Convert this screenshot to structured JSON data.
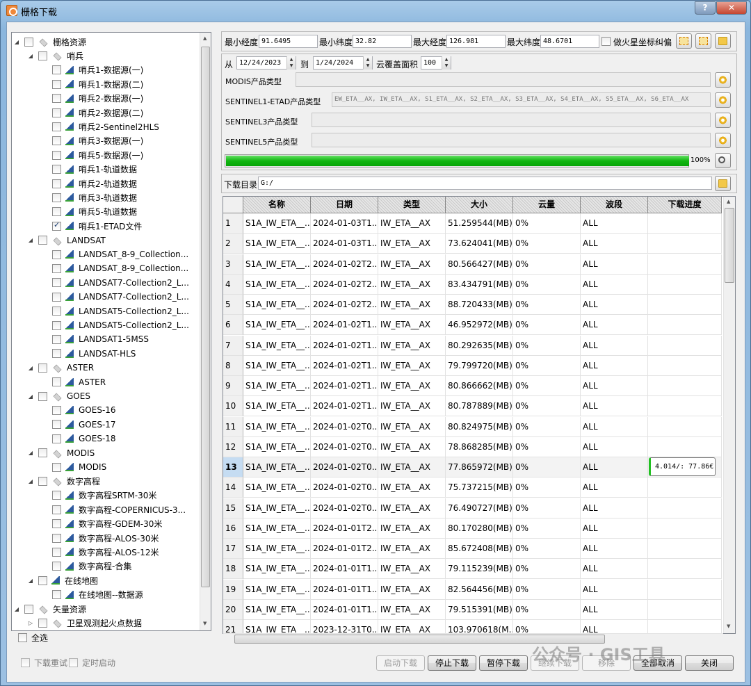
{
  "window": {
    "title": "栅格下载",
    "help_label": "?",
    "close_label": "✕"
  },
  "tree": {
    "items": [
      {
        "label": "栅格资源",
        "level": 0,
        "type": "layer",
        "expanded": true,
        "checked": false
      },
      {
        "label": "哨兵",
        "level": 1,
        "type": "layer",
        "expanded": true,
        "checked": false
      },
      {
        "label": "哨兵1-数据源(一)",
        "level": 2,
        "type": "raster",
        "checked": false
      },
      {
        "label": "哨兵1-数据源(二)",
        "level": 2,
        "type": "raster",
        "checked": false
      },
      {
        "label": "哨兵2-数据源(一)",
        "level": 2,
        "type": "raster",
        "checked": false
      },
      {
        "label": "哨兵2-数据源(二)",
        "level": 2,
        "type": "raster",
        "checked": false
      },
      {
        "label": "哨兵2-Sentinel2HLS",
        "level": 2,
        "type": "raster",
        "checked": false
      },
      {
        "label": "哨兵3-数据源(一)",
        "level": 2,
        "type": "raster",
        "checked": false
      },
      {
        "label": "哨兵5-数据源(一)",
        "level": 2,
        "type": "raster",
        "checked": false
      },
      {
        "label": "哨兵1-轨道数据",
        "level": 2,
        "type": "raster",
        "checked": false
      },
      {
        "label": "哨兵2-轨道数据",
        "level": 2,
        "type": "raster",
        "checked": false
      },
      {
        "label": "哨兵3-轨道数据",
        "level": 2,
        "type": "raster",
        "checked": false
      },
      {
        "label": "哨兵5-轨道数据",
        "level": 2,
        "type": "raster",
        "checked": false
      },
      {
        "label": "哨兵1-ETAD文件",
        "level": 2,
        "type": "raster",
        "checked": true
      },
      {
        "label": "LANDSAT",
        "level": 1,
        "type": "layer",
        "expanded": true,
        "checked": false
      },
      {
        "label": "LANDSAT_8-9_Collection...",
        "level": 2,
        "type": "raster",
        "checked": false
      },
      {
        "label": "LANDSAT_8-9_Collection...",
        "level": 2,
        "type": "raster",
        "checked": false
      },
      {
        "label": "LANDSAT7-Collection2_L...",
        "level": 2,
        "type": "raster",
        "checked": false
      },
      {
        "label": "LANDSAT7-Collection2_L...",
        "level": 2,
        "type": "raster",
        "checked": false
      },
      {
        "label": "LANDSAT5-Collection2_L...",
        "level": 2,
        "type": "raster",
        "checked": false
      },
      {
        "label": "LANDSAT5-Collection2_L...",
        "level": 2,
        "type": "raster",
        "checked": false
      },
      {
        "label": "LANDSAT1-5MSS",
        "level": 2,
        "type": "raster",
        "checked": false
      },
      {
        "label": "LANDSAT-HLS",
        "level": 2,
        "type": "raster",
        "checked": false
      },
      {
        "label": "ASTER",
        "level": 1,
        "type": "layer",
        "expanded": true,
        "checked": false
      },
      {
        "label": "ASTER",
        "level": 2,
        "type": "raster",
        "checked": false
      },
      {
        "label": "GOES",
        "level": 1,
        "type": "layer",
        "expanded": true,
        "checked": false
      },
      {
        "label": "GOES-16",
        "level": 2,
        "type": "raster",
        "checked": false
      },
      {
        "label": "GOES-17",
        "level": 2,
        "type": "raster",
        "checked": false
      },
      {
        "label": "GOES-18",
        "level": 2,
        "type": "raster",
        "checked": false
      },
      {
        "label": "MODIS",
        "level": 1,
        "type": "layer",
        "expanded": true,
        "checked": false
      },
      {
        "label": "MODIS",
        "level": 2,
        "type": "raster",
        "checked": false
      },
      {
        "label": "数字高程",
        "level": 1,
        "type": "layer",
        "expanded": true,
        "checked": false
      },
      {
        "label": "数字高程SRTM-30米",
        "level": 2,
        "type": "raster",
        "checked": false
      },
      {
        "label": "数字高程-COPERNICUS-3...",
        "level": 2,
        "type": "raster",
        "checked": false
      },
      {
        "label": "数字高程-GDEM-30米",
        "level": 2,
        "type": "raster",
        "checked": false
      },
      {
        "label": "数字高程-ALOS-30米",
        "level": 2,
        "type": "raster",
        "checked": false
      },
      {
        "label": "数字高程-ALOS-12米",
        "level": 2,
        "type": "raster",
        "checked": false
      },
      {
        "label": "数字高程-合集",
        "level": 2,
        "type": "raster",
        "checked": false
      },
      {
        "label": "在线地图",
        "level": 1,
        "type": "raster",
        "expanded": true,
        "checked": false
      },
      {
        "label": "在线地图--数据源",
        "level": 2,
        "type": "raster",
        "checked": false
      },
      {
        "label": "矢量资源",
        "level": 0,
        "type": "layer",
        "expanded": true,
        "checked": false
      },
      {
        "label": "卫星观测起火点数据",
        "level": 1,
        "type": "layer",
        "checked": false
      }
    ],
    "select_all_label": "全选"
  },
  "bbox": {
    "min_lon_label": "最小经度",
    "min_lon": "91.6495",
    "min_lat_label": "最小纬度",
    "min_lat": "32.82",
    "max_lon_label": "最大经度",
    "max_lon": "126.981",
    "max_lat_label": "最大纬度",
    "max_lat": "48.6701",
    "mars_label": "做火星坐标纠偏"
  },
  "date": {
    "from_label": "从",
    "from": "12/24/2023",
    "to_label": "到",
    "to": "1/24/2024",
    "cloud_label": "云覆盖面积",
    "cloud": "100"
  },
  "products": [
    {
      "label": "MODIS产品类型",
      "value": ""
    },
    {
      "label": "SENTINEL1-ETAD产品类型",
      "value": "EW_ETA__AX, IW_ETA__AX, S1_ETA__AX, S2_ETA__AX, S3_ETA__AX, S4_ETA__AX, S5_ETA__AX, S6_ETA__AX"
    },
    {
      "label": "SENTINEL3产品类型",
      "value": ""
    },
    {
      "label": "SENTINEL5产品类型",
      "value": ""
    }
  ],
  "progress": {
    "percent": 100,
    "text": "100%"
  },
  "download_dir": {
    "label": "下载目录",
    "value": "G:/"
  },
  "table": {
    "headers": [
      "名称",
      "日期",
      "类型",
      "大小",
      "云量",
      "波段",
      "下载进度"
    ],
    "rows": [
      {
        "n": "1",
        "name": "S1A_IW_ETA__...",
        "date": "2024-01-03T1...",
        "type": "IW_ETA__AX",
        "size": "51.259544(MB)",
        "cloud": "0%",
        "band": "ALL",
        "progress": ""
      },
      {
        "n": "2",
        "name": "S1A_IW_ETA__...",
        "date": "2024-01-03T1...",
        "type": "IW_ETA__AX",
        "size": "73.624041(MB)",
        "cloud": "0%",
        "band": "ALL",
        "progress": ""
      },
      {
        "n": "3",
        "name": "S1A_IW_ETA__...",
        "date": "2024-01-02T2...",
        "type": "IW_ETA__AX",
        "size": "80.566427(MB)",
        "cloud": "0%",
        "band": "ALL",
        "progress": ""
      },
      {
        "n": "4",
        "name": "S1A_IW_ETA__...",
        "date": "2024-01-02T2...",
        "type": "IW_ETA__AX",
        "size": "83.434791(MB)",
        "cloud": "0%",
        "band": "ALL",
        "progress": ""
      },
      {
        "n": "5",
        "name": "S1A_IW_ETA__...",
        "date": "2024-01-02T2...",
        "type": "IW_ETA__AX",
        "size": "88.720433(MB)",
        "cloud": "0%",
        "band": "ALL",
        "progress": ""
      },
      {
        "n": "6",
        "name": "S1A_IW_ETA__...",
        "date": "2024-01-02T1...",
        "type": "IW_ETA__AX",
        "size": "46.952972(MB)",
        "cloud": "0%",
        "band": "ALL",
        "progress": ""
      },
      {
        "n": "7",
        "name": "S1A_IW_ETA__...",
        "date": "2024-01-02T1...",
        "type": "IW_ETA__AX",
        "size": "80.292635(MB)",
        "cloud": "0%",
        "band": "ALL",
        "progress": ""
      },
      {
        "n": "8",
        "name": "S1A_IW_ETA__...",
        "date": "2024-01-02T1...",
        "type": "IW_ETA__AX",
        "size": "79.799720(MB)",
        "cloud": "0%",
        "band": "ALL",
        "progress": ""
      },
      {
        "n": "9",
        "name": "S1A_IW_ETA__...",
        "date": "2024-01-02T1...",
        "type": "IW_ETA__AX",
        "size": "80.866662(MB)",
        "cloud": "0%",
        "band": "ALL",
        "progress": ""
      },
      {
        "n": "10",
        "name": "S1A_IW_ETA__...",
        "date": "2024-01-02T1...",
        "type": "IW_ETA__AX",
        "size": "80.787889(MB)",
        "cloud": "0%",
        "band": "ALL",
        "progress": ""
      },
      {
        "n": "11",
        "name": "S1A_IW_ETA__...",
        "date": "2024-01-02T0...",
        "type": "IW_ETA__AX",
        "size": "80.824975(MB)",
        "cloud": "0%",
        "band": "ALL",
        "progress": ""
      },
      {
        "n": "12",
        "name": "S1A_IW_ETA__...",
        "date": "2024-01-02T0...",
        "type": "IW_ETA__AX",
        "size": "78.868285(MB)",
        "cloud": "0%",
        "band": "ALL",
        "progress": ""
      },
      {
        "n": "13",
        "name": "S1A_IW_ETA__...",
        "date": "2024-01-02T0...",
        "type": "IW_ETA__AX",
        "size": "77.865972(MB)",
        "cloud": "0%",
        "band": "ALL",
        "progress": "4.014/:  77.86€"
      },
      {
        "n": "14",
        "name": "S1A_IW_ETA__...",
        "date": "2024-01-02T0...",
        "type": "IW_ETA__AX",
        "size": "75.737215(MB)",
        "cloud": "0%",
        "band": "ALL",
        "progress": ""
      },
      {
        "n": "15",
        "name": "S1A_IW_ETA__...",
        "date": "2024-01-02T0...",
        "type": "IW_ETA__AX",
        "size": "76.490727(MB)",
        "cloud": "0%",
        "band": "ALL",
        "progress": ""
      },
      {
        "n": "16",
        "name": "S1A_IW_ETA__...",
        "date": "2024-01-01T2...",
        "type": "IW_ETA__AX",
        "size": "80.170280(MB)",
        "cloud": "0%",
        "band": "ALL",
        "progress": ""
      },
      {
        "n": "17",
        "name": "S1A_IW_ETA__...",
        "date": "2024-01-01T2...",
        "type": "IW_ETA__AX",
        "size": "85.672408(MB)",
        "cloud": "0%",
        "band": "ALL",
        "progress": ""
      },
      {
        "n": "18",
        "name": "S1A_IW_ETA__...",
        "date": "2024-01-01T1...",
        "type": "IW_ETA__AX",
        "size": "79.115239(MB)",
        "cloud": "0%",
        "band": "ALL",
        "progress": ""
      },
      {
        "n": "19",
        "name": "S1A_IW_ETA__...",
        "date": "2024-01-01T1...",
        "type": "IW_ETA__AX",
        "size": "82.564456(MB)",
        "cloud": "0%",
        "band": "ALL",
        "progress": ""
      },
      {
        "n": "20",
        "name": "S1A_IW_ETA__...",
        "date": "2024-01-01T1...",
        "type": "IW_ETA__AX",
        "size": "79.515391(MB)",
        "cloud": "0%",
        "band": "ALL",
        "progress": ""
      },
      {
        "n": "21",
        "name": "S1A_IW_ETA__...",
        "date": "2023-12-31T0...",
        "type": "IW_ETA__AX",
        "size": "103.970618(M...",
        "cloud": "0%",
        "band": "ALL",
        "progress": ""
      }
    ],
    "selected_row": "13"
  },
  "bottom": {
    "retry_label": "下载重试",
    "timer_label": "定时启动",
    "start_label": "启动下载",
    "stop_label": "停止下载",
    "pause_label": "暂停下载",
    "resume_label": "继续下载",
    "remove_label": "移除",
    "cancel_all_label": "全部取消",
    "close_label": "关闭"
  },
  "watermark": "公众号 · GIS工具",
  "colors": {
    "progress_green": "#11b611",
    "selected_row": "#c5dcf2",
    "title_bar": "#a9cbe9"
  }
}
